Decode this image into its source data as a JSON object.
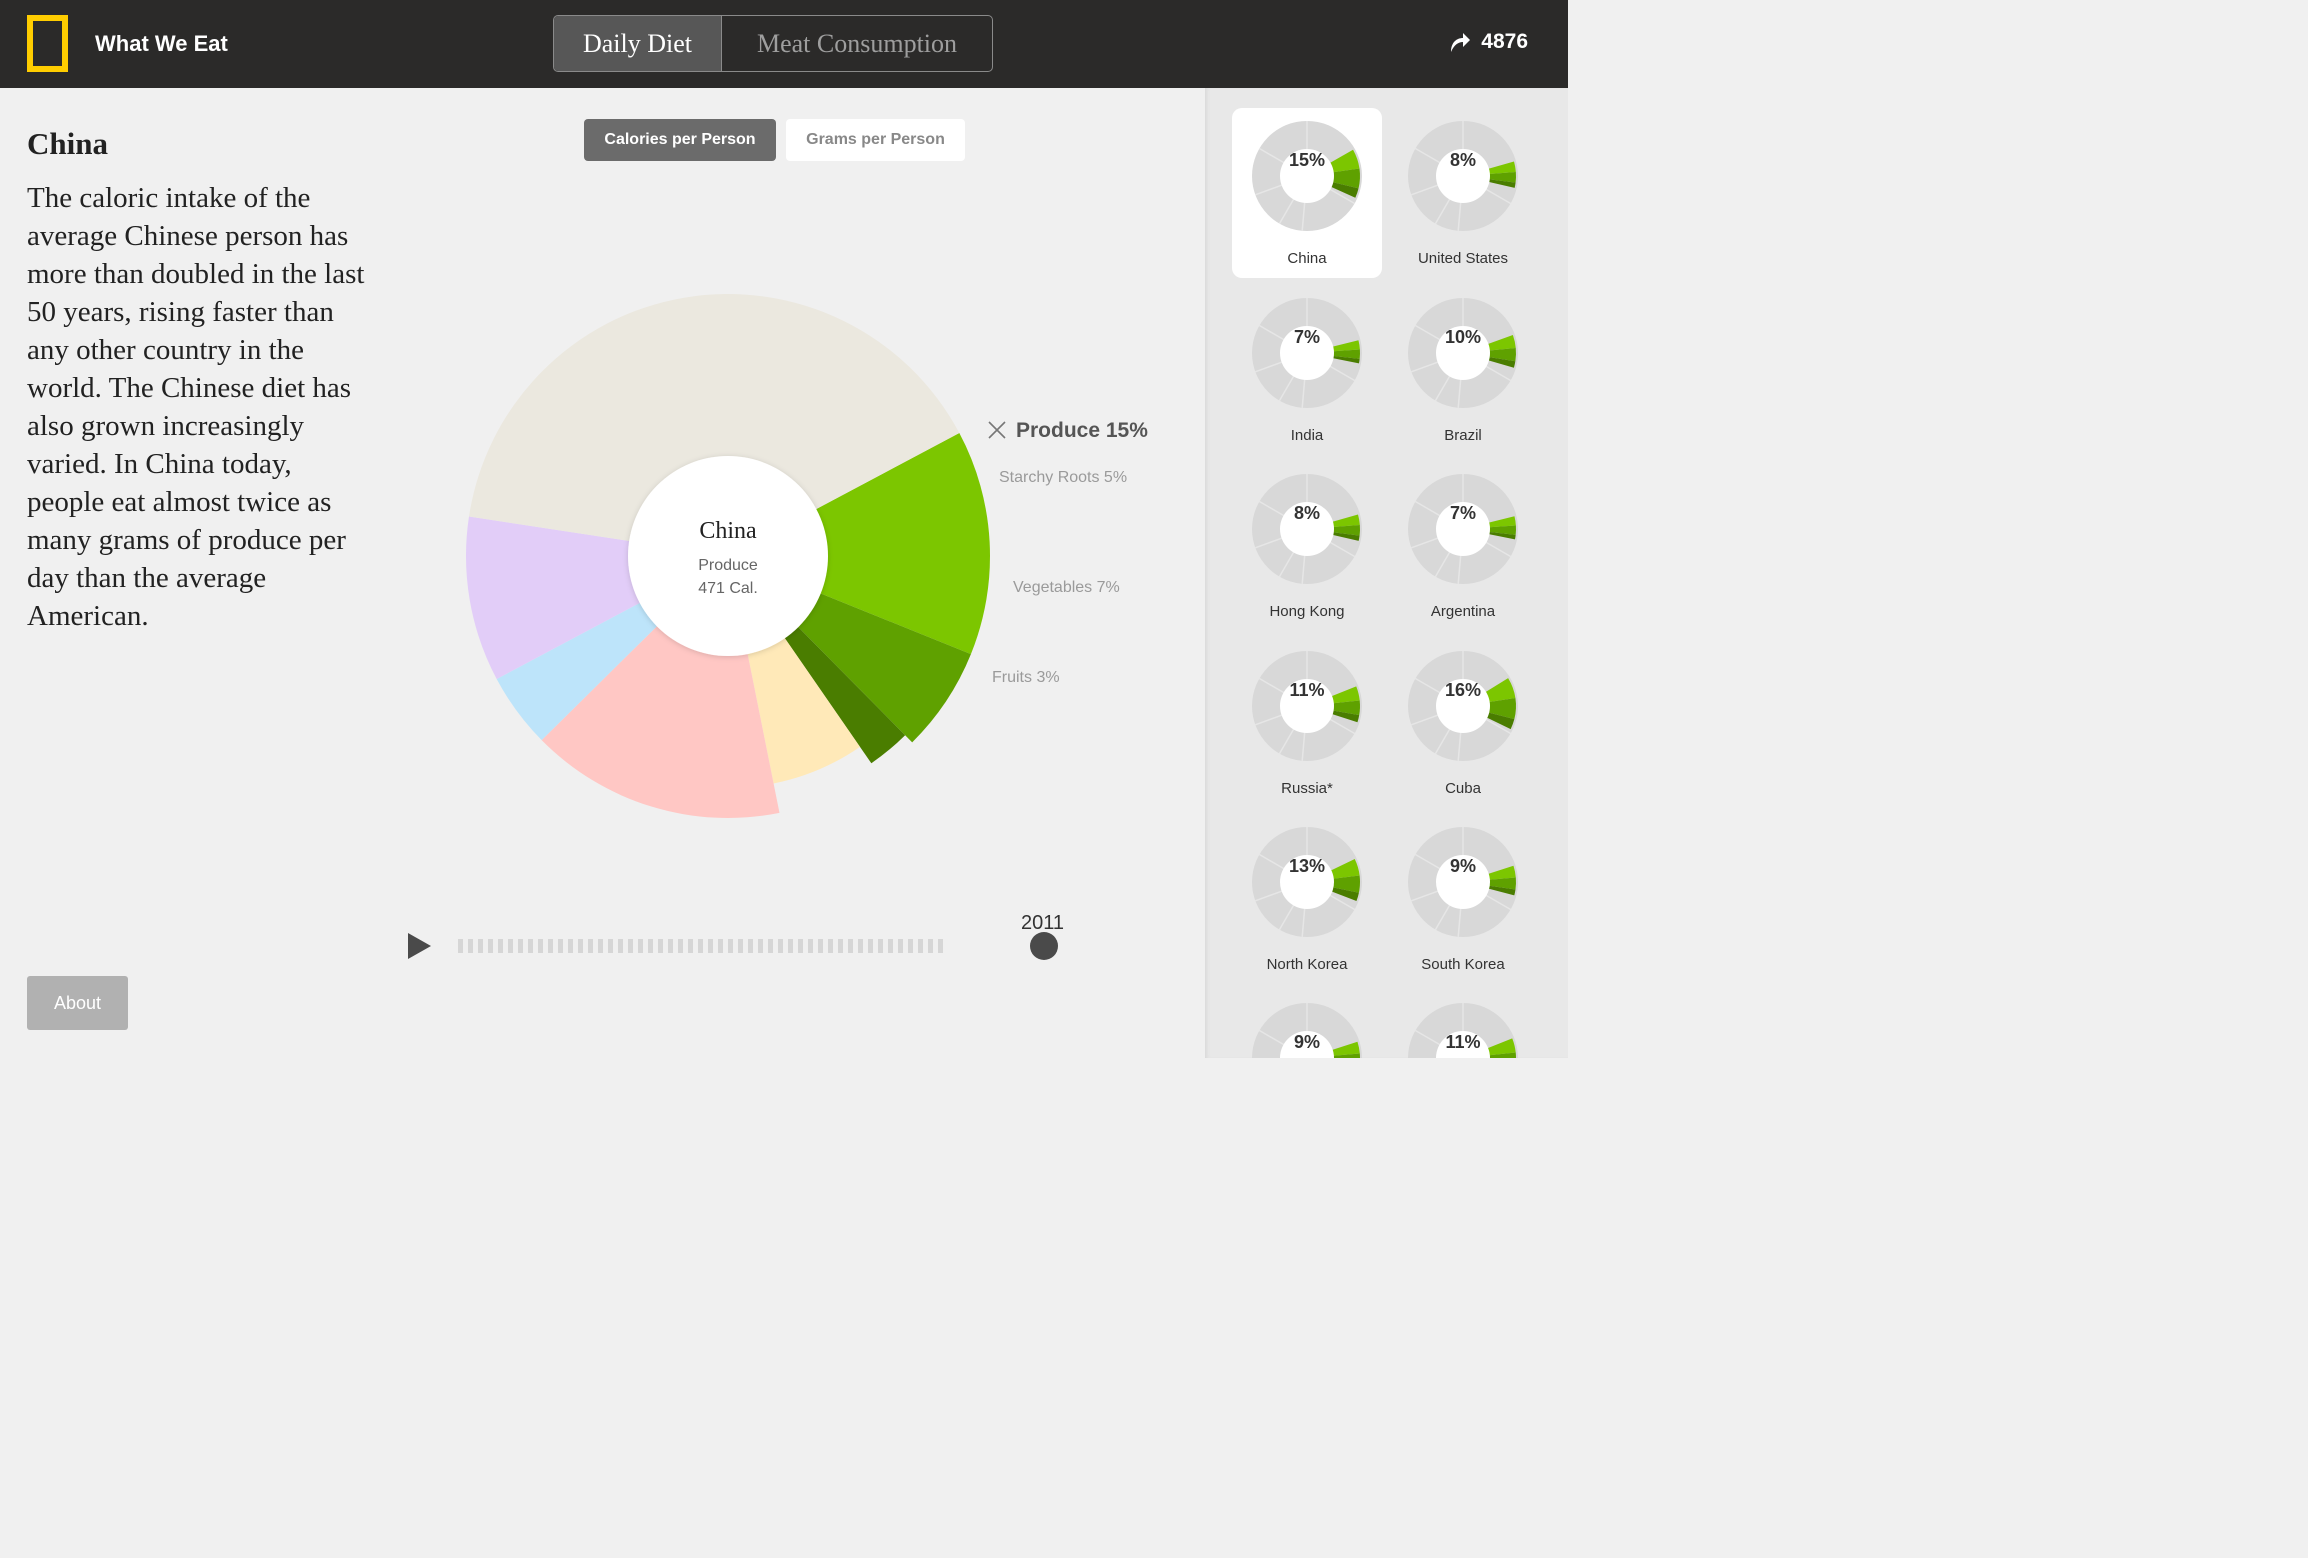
{
  "header": {
    "app_title": "What We Eat",
    "tabs": [
      {
        "label": "Daily Diet",
        "active": true
      },
      {
        "label": "Meat Consumption",
        "active": false
      }
    ],
    "share_count": "4876",
    "logo_color": "#ffcd00"
  },
  "content": {
    "country": "China",
    "description": "The caloric intake of the average Chinese person has more than doubled in the last 50 years, rising faster than any other country in the world. The Chinese diet has also grown increasingly varied. In China today, people eat almost twice as many grams of produce per day than the average American.",
    "toggle": {
      "calories": "Calories per Person",
      "grams": "Grams per Person",
      "selected": "calories"
    },
    "about": "About"
  },
  "chart_data": {
    "type": "pie",
    "center": {
      "title": "China",
      "category": "Produce",
      "value": "471 Cal."
    },
    "selected": {
      "label": "Produce 15%",
      "close_icon": "close-icon"
    },
    "slices": [
      {
        "value": 15,
        "color": "#7cc600",
        "label": "Starchy Roots 5%"
      },
      {
        "value": 7,
        "color": "#5fa100",
        "label": "Vegetables 7%"
      },
      {
        "value": 3,
        "color": "#4a7d00",
        "label": "Fruits 3%"
      },
      {
        "value": 7,
        "color": "#ffe9b8",
        "label": ""
      },
      {
        "value": 17,
        "color": "#ffc7c4",
        "label": ""
      },
      {
        "value": 5,
        "color": "#bde4fa",
        "label": ""
      },
      {
        "value": 11,
        "color": "#e2cdf8",
        "label": ""
      },
      {
        "value": 43,
        "color": "#ebe8df",
        "label": ""
      }
    ]
  },
  "timeline": {
    "year": "2011",
    "steps": 49
  },
  "countries": [
    {
      "name": "China",
      "pct": "15%",
      "value": 15,
      "selected": true
    },
    {
      "name": "United States",
      "pct": "8%",
      "value": 8
    },
    {
      "name": "India",
      "pct": "7%",
      "value": 7
    },
    {
      "name": "Brazil",
      "pct": "10%",
      "value": 10
    },
    {
      "name": "Hong Kong",
      "pct": "8%",
      "value": 8
    },
    {
      "name": "Argentina",
      "pct": "7%",
      "value": 7
    },
    {
      "name": "Russia*",
      "pct": "11%",
      "value": 11
    },
    {
      "name": "Cuba",
      "pct": "16%",
      "value": 16
    },
    {
      "name": "North Korea",
      "pct": "13%",
      "value": 13
    },
    {
      "name": "South Korea",
      "pct": "9%",
      "value": 9
    },
    {
      "name": "",
      "pct": "9%",
      "value": 9
    },
    {
      "name": "",
      "pct": "11%",
      "value": 11
    }
  ]
}
